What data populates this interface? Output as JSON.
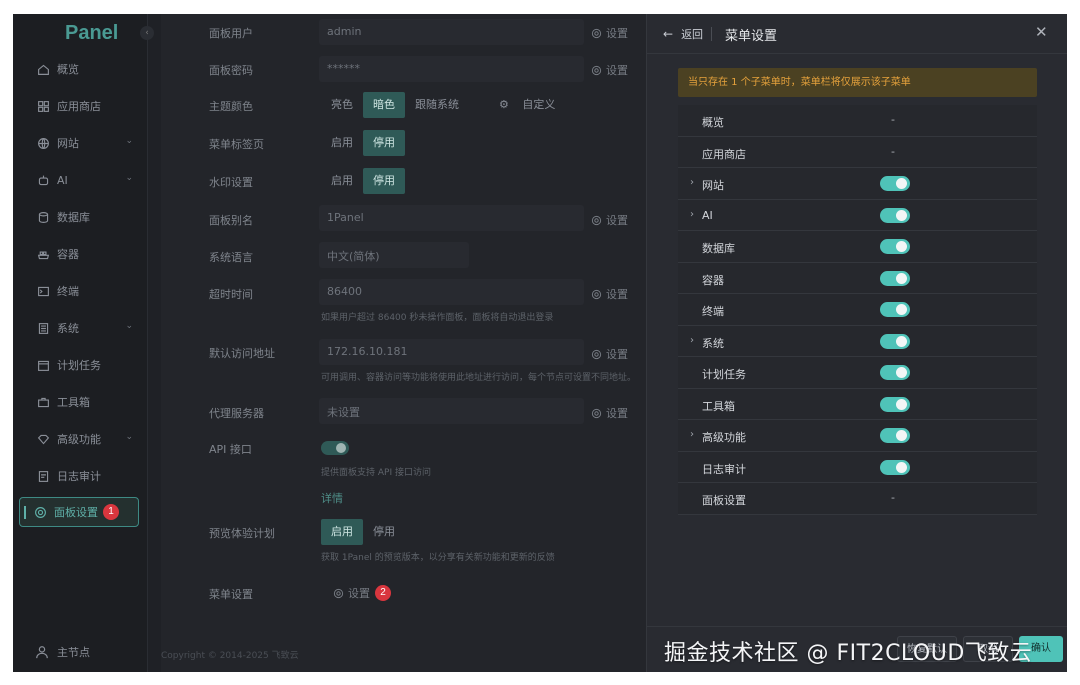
{
  "sidebar": {
    "logo": "Panel",
    "items": [
      {
        "label": "概览",
        "icon": "home-icon"
      },
      {
        "label": "应用商店",
        "icon": "grid-icon"
      },
      {
        "label": "网站",
        "icon": "globe-icon",
        "expandable": true
      },
      {
        "label": "AI",
        "icon": "robot-icon",
        "expandable": true
      },
      {
        "label": "数据库",
        "icon": "database-icon"
      },
      {
        "label": "容器",
        "icon": "container-icon"
      },
      {
        "label": "终端",
        "icon": "terminal-icon"
      },
      {
        "label": "系统",
        "icon": "system-icon",
        "expandable": true
      },
      {
        "label": "计划任务",
        "icon": "calendar-icon"
      },
      {
        "label": "工具箱",
        "icon": "toolbox-icon"
      },
      {
        "label": "高级功能",
        "icon": "diamond-icon",
        "expandable": true
      },
      {
        "label": "日志审计",
        "icon": "log-icon"
      }
    ],
    "active_item": {
      "label": "面板设置",
      "badge": "1"
    },
    "bottom_node": "主节点"
  },
  "settings": {
    "panel_user": {
      "label": "面板用户",
      "value": "admin",
      "action": "设置"
    },
    "panel_password": {
      "label": "面板密码",
      "value": "******",
      "action": "设置"
    },
    "theme": {
      "label": "主题颜色",
      "options": [
        "亮色",
        "暗色",
        "跟随系统"
      ],
      "selected": "暗色",
      "custom": "自定义"
    },
    "menu_tabs": {
      "label": "菜单标签页",
      "options": [
        "启用",
        "停用"
      ],
      "selected": "停用"
    },
    "watermark": {
      "label": "水印设置",
      "options": [
        "启用",
        "停用"
      ],
      "selected": "停用"
    },
    "panel_alias": {
      "label": "面板别名",
      "value": "1Panel",
      "action": "设置"
    },
    "language": {
      "label": "系统语言",
      "value": "中文(简体)"
    },
    "timeout": {
      "label": "超时时间",
      "value": "86400",
      "action": "设置",
      "hint": "如果用户超过 86400 秒未操作面板，面板将自动退出登录"
    },
    "default_address": {
      "label": "默认访问地址",
      "value": "172.16.10.181",
      "action": "设置",
      "hint": "可用调用、容器访问等功能将使用此地址进行访问，每个节点可设置不同地址。"
    },
    "proxy": {
      "label": "代理服务器",
      "value": "未设置",
      "action": "设置"
    },
    "api": {
      "label": "API 接口",
      "hint": "提供面板支持 API 接口访问",
      "detail": "详情"
    },
    "preview": {
      "label": "预览体验计划",
      "options": [
        "启用",
        "停用"
      ],
      "selected": "启用",
      "hint": "获取 1Panel 的预览版本，以分享有关新功能和更新的反馈"
    },
    "menu_settings": {
      "label": "菜单设置",
      "action": "设置",
      "badge": "2"
    }
  },
  "copyright": "Copyright © 2014-2025 飞致云",
  "drawer": {
    "back": "返回",
    "title": "菜单设置",
    "warning": "当只存在 1 个子菜单时，菜单栏将仅展示该子菜单",
    "rows": [
      {
        "name": "概览",
        "expandable": false,
        "toggle": null,
        "dash": "-"
      },
      {
        "name": "应用商店",
        "expandable": false,
        "toggle": null,
        "dash": "-"
      },
      {
        "name": "网站",
        "expandable": true,
        "toggle": true
      },
      {
        "name": "AI",
        "expandable": true,
        "toggle": true
      },
      {
        "name": "数据库",
        "expandable": false,
        "toggle": true
      },
      {
        "name": "容器",
        "expandable": false,
        "toggle": true
      },
      {
        "name": "终端",
        "expandable": false,
        "toggle": true
      },
      {
        "name": "系统",
        "expandable": true,
        "toggle": true
      },
      {
        "name": "计划任务",
        "expandable": false,
        "toggle": true
      },
      {
        "name": "工具箱",
        "expandable": false,
        "toggle": true
      },
      {
        "name": "高级功能",
        "expandable": true,
        "toggle": true
      },
      {
        "name": "日志审计",
        "expandable": false,
        "toggle": true
      },
      {
        "name": "面板设置",
        "expandable": false,
        "toggle": null,
        "dash": "-"
      }
    ],
    "footer": {
      "reset": "恢复默认",
      "cancel": "取消",
      "confirm": "确认"
    }
  },
  "watermark_text": "掘金技术社区 @ FIT2CLOUD飞致云",
  "colors": {
    "accent": "#4fc3b8",
    "warning_text": "#e6a23c",
    "badge": "#d9363e"
  }
}
